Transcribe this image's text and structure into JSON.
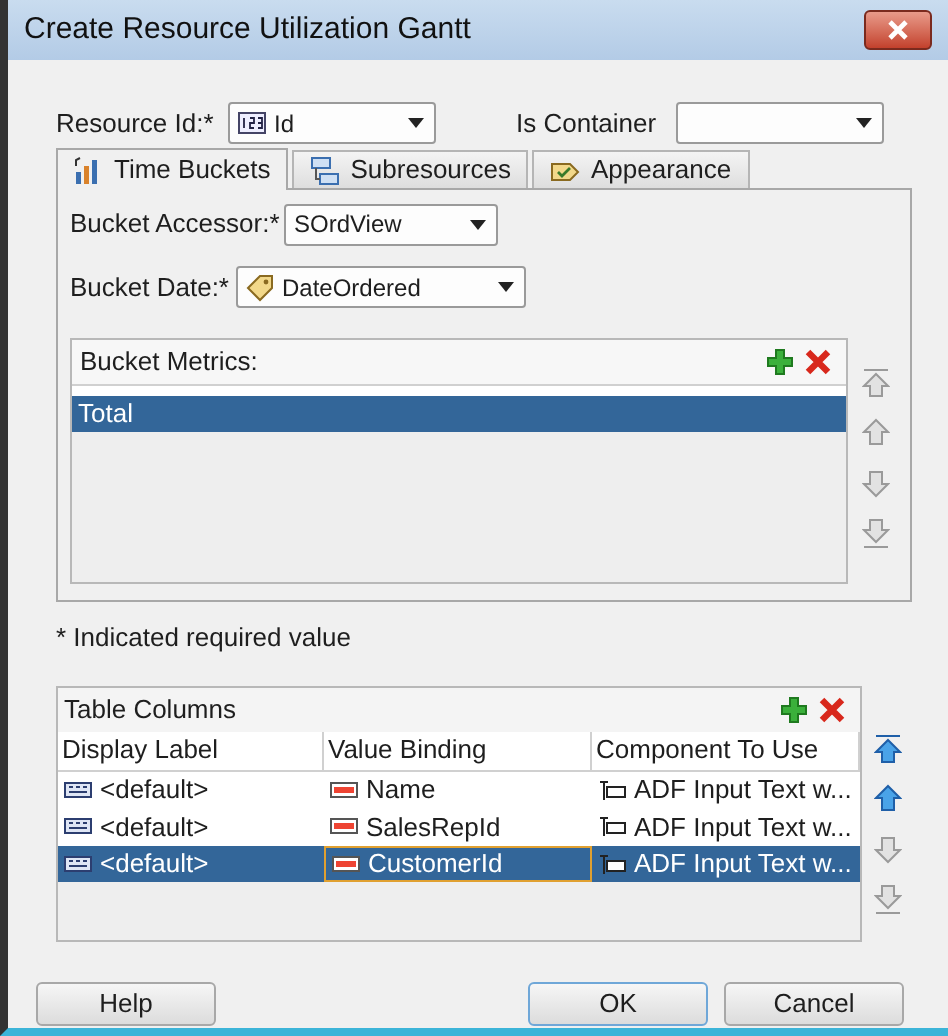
{
  "window": {
    "title": "Create Resource Utilization Gantt"
  },
  "resource_id": {
    "label": "Resource Id:*",
    "value": "Id"
  },
  "is_container": {
    "label": "Is Container"
  },
  "tabs": [
    {
      "label": "Time Buckets",
      "kind": "buckets",
      "selected": true
    },
    {
      "label": "Subresources",
      "kind": "subresources",
      "selected": false
    },
    {
      "label": "Appearance",
      "kind": "appearance",
      "selected": false
    }
  ],
  "bucket_accessor": {
    "label": "Bucket Accessor:*",
    "value": "SOrdView"
  },
  "bucket_date": {
    "label": "Bucket Date:*",
    "value": "DateOrdered"
  },
  "bucket_metrics": {
    "title": "Bucket Metrics:",
    "items": [
      {
        "label": "Total",
        "selected": true
      }
    ],
    "move_buttons": [
      {
        "kind": "top",
        "disabled": true
      },
      {
        "kind": "up",
        "disabled": true
      },
      {
        "kind": "down",
        "disabled": true
      },
      {
        "kind": "bottom",
        "disabled": true
      }
    ]
  },
  "required_note": "* Indicated required value",
  "table_columns": {
    "title": "Table Columns",
    "columns": [
      "Display Label",
      "Value Binding",
      "Component To Use"
    ],
    "rows": [
      {
        "display_label": "<default>",
        "value_binding": "Name",
        "component": "ADF Input Text w...",
        "selected": false
      },
      {
        "display_label": "<default>",
        "value_binding": "SalesRepId",
        "component": "ADF Input Text w...",
        "selected": false
      },
      {
        "display_label": "<default>",
        "value_binding": "CustomerId",
        "component": "ADF Input Text w...",
        "selected": true
      }
    ],
    "move_buttons": [
      {
        "kind": "top",
        "disabled": false
      },
      {
        "kind": "up",
        "disabled": false
      },
      {
        "kind": "down",
        "disabled": true
      },
      {
        "kind": "bottom",
        "disabled": true
      }
    ]
  },
  "buttons": [
    {
      "label": "Help",
      "default": false
    },
    {
      "label": "OK",
      "default": true
    },
    {
      "label": "Cancel",
      "default": false
    }
  ]
}
